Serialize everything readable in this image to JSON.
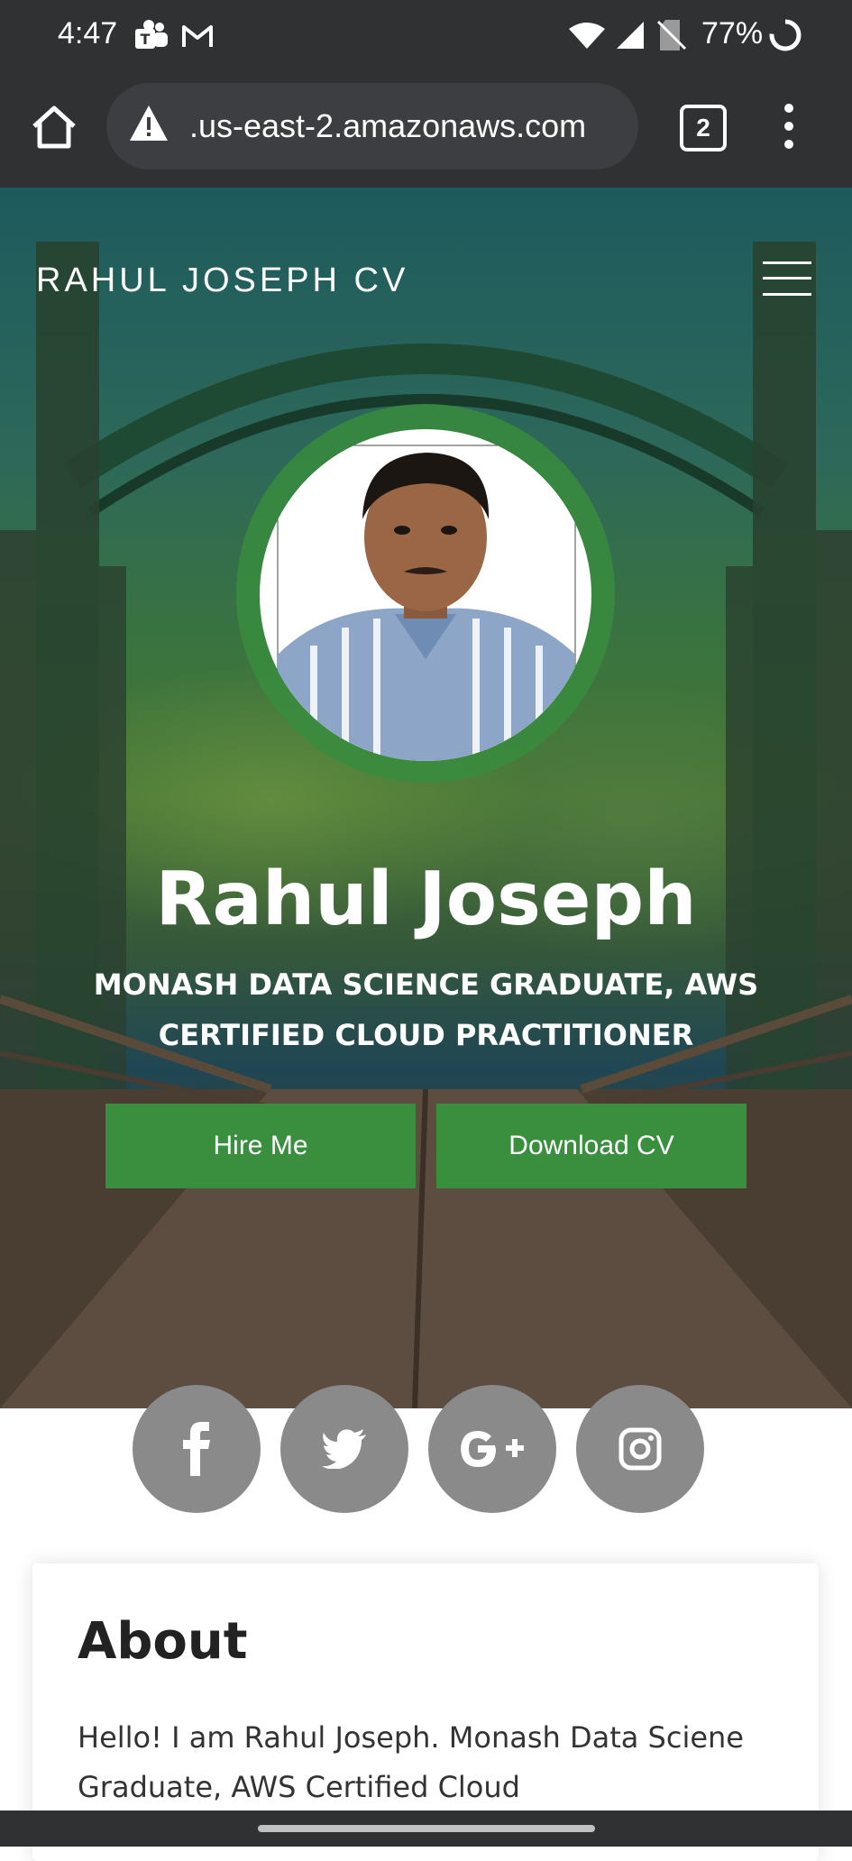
{
  "status_bar": {
    "time": "4:47",
    "battery": "77%",
    "icons": [
      "teams-icon",
      "gmail-icon",
      "wifi-icon",
      "signal-icon",
      "no-sim-icon",
      "battery-icon"
    ]
  },
  "browser": {
    "url": ".us-east-2.amazonaws.com",
    "tab_count": "2",
    "security": "not-secure-warning-icon"
  },
  "hero": {
    "brand": "RAHUL JOSEPH CV",
    "name": "Rahul Joseph",
    "subtitle": "MONASH DATA SCIENCE GRADUATE, AWS CERTIFIED CLOUD PRACTITIONER",
    "buttons": {
      "hire": "Hire Me",
      "download": "Download CV"
    }
  },
  "social": [
    "facebook-icon",
    "twitter-icon",
    "google-plus-icon",
    "instagram-icon"
  ],
  "about": {
    "title": "About",
    "text": "Hello! I am Rahul Joseph. Monash Data Sciene Graduate, AWS Certified Cloud"
  },
  "colors": {
    "accent_green": "#3a8f3f",
    "social_gray": "#8a8a8a",
    "chrome_dark": "#2f3133"
  }
}
